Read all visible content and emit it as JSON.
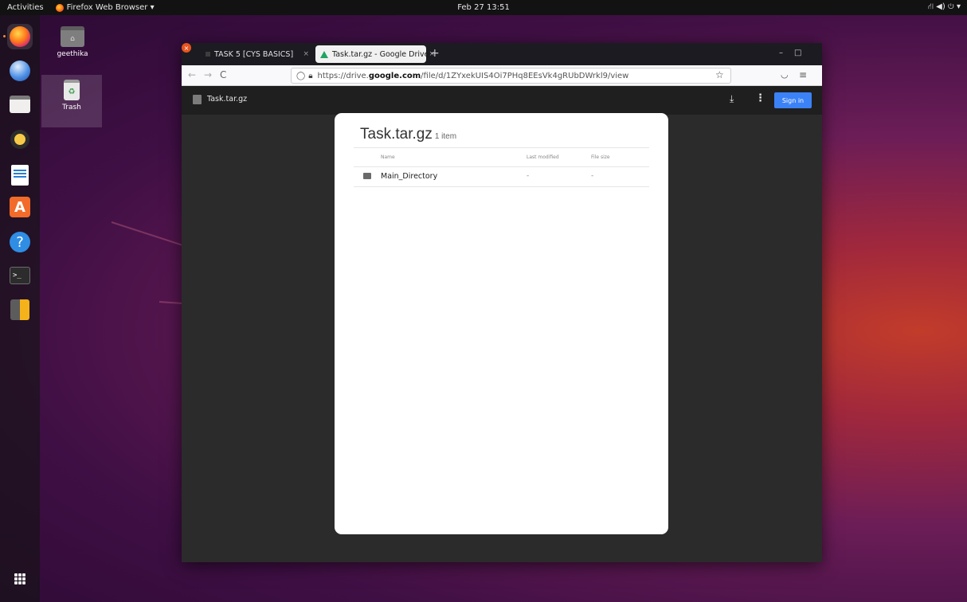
{
  "topbar": {
    "activities": "Activities",
    "app_name": "Firefox Web Browser ▾",
    "clock": "Feb 27  13:51",
    "tray": "⛙ ◀) ⏻ ▾"
  },
  "desktop": {
    "home_label": "geethika",
    "trash_label": "Trash"
  },
  "browser": {
    "tabs": [
      {
        "label": "TASK 5 [CYS BASICS]",
        "close": "×"
      },
      {
        "label": "Task.tar.gz - Google Drive",
        "close": "×"
      }
    ],
    "new_tab": "+",
    "window_controls": {
      "minimize": "–",
      "maximize": "□",
      "close": "×"
    },
    "nav": {
      "back": "←",
      "forward": "→",
      "reload": "C",
      "star": "☆",
      "pocket": "◡",
      "menu": "≡"
    },
    "url": {
      "prefix": "https://drive.",
      "host": "google.com",
      "suffix": "/file/d/1ZYxekUIS4Oi7PHq8EEsVk4gRUbDWrkl9/view"
    }
  },
  "drive": {
    "file_title": "Task.tar.gz",
    "download_icon": "⤓",
    "more_icon": "⋮",
    "sign_in": "Sign in"
  },
  "archive": {
    "title": "Task.tar.gz",
    "count": "1 item",
    "columns": {
      "name": "Name",
      "modified": "Last modified",
      "size": "File size"
    },
    "rows": [
      {
        "name": "Main_Directory",
        "modified": "-",
        "size": "-"
      }
    ]
  },
  "colors": {
    "signin": "#3b82f6",
    "drive_icon": "#1fa463",
    "close_button": "#e9541e"
  }
}
